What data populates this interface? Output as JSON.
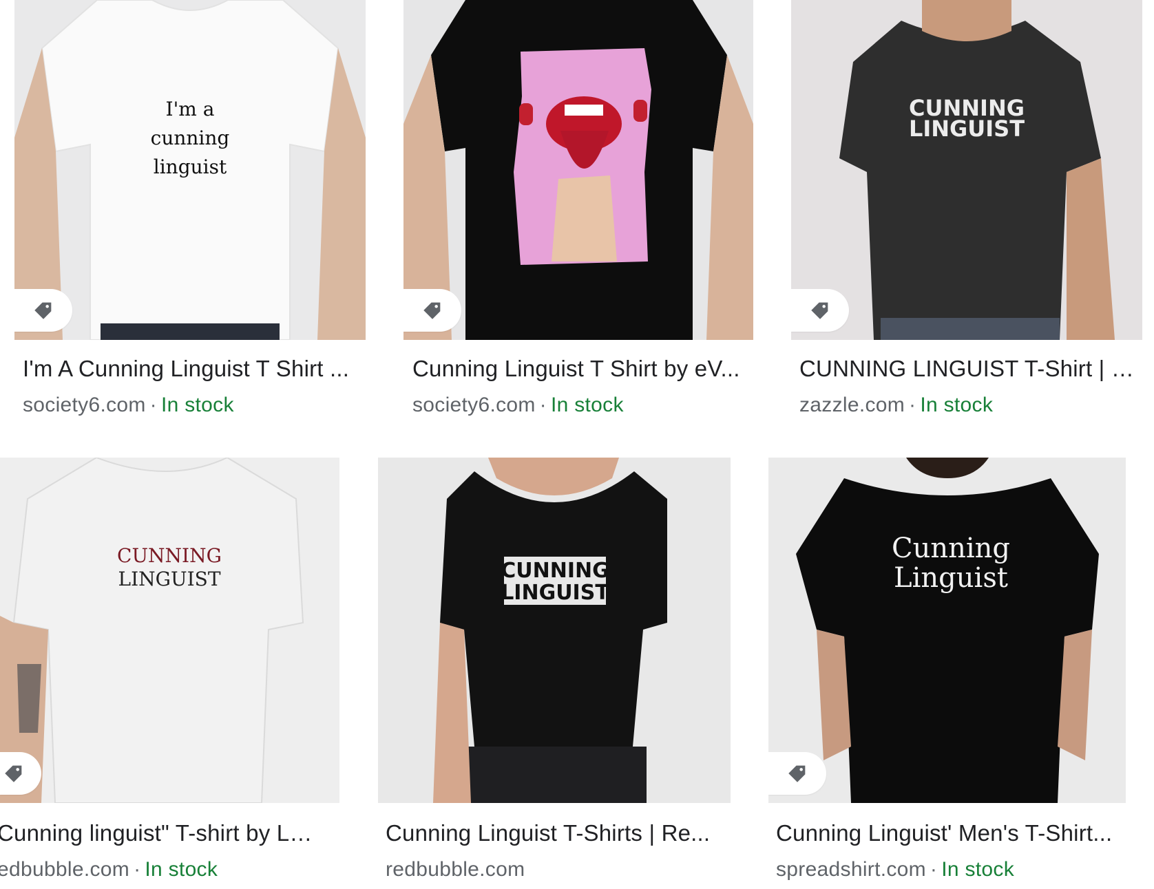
{
  "results": [
    {
      "title": "I'm A Cunning Linguist T Shirt ...",
      "source": "society6.com",
      "stock": "In stock",
      "print": [
        "I'm a",
        "cunning",
        "linguist"
      ]
    },
    {
      "title": "Cunning Linguist T Shirt by eV...",
      "source": "society6.com",
      "stock": "In stock"
    },
    {
      "title": "CUNNING LINGUIST T-Shirt | Z...",
      "source": "zazzle.com",
      "stock": "In stock",
      "print": [
        "CUNNING",
        "LINGUIST"
      ]
    },
    {
      "title": "Cunning linguist\" T-shirt by Ln...",
      "source": "edbubble.com",
      "stock": "In stock",
      "print": [
        "CUNNING",
        "LINGUIST"
      ]
    },
    {
      "title": "Cunning Linguist T-Shirts | Re...",
      "source": "redbubble.com",
      "stock": "",
      "print": [
        "CUNNING",
        "LINGUIST"
      ]
    },
    {
      "title": "Cunning Linguist' Men's T-Shirt...",
      "source": "spreadshirt.com",
      "stock": "In stock",
      "print": [
        "Cunning",
        "Linguist"
      ]
    }
  ],
  "separator": "·",
  "icons": {
    "tag": "price-tag-icon"
  },
  "colors": {
    "title": "#202124",
    "source": "#5f6368",
    "stock": "#188038"
  }
}
